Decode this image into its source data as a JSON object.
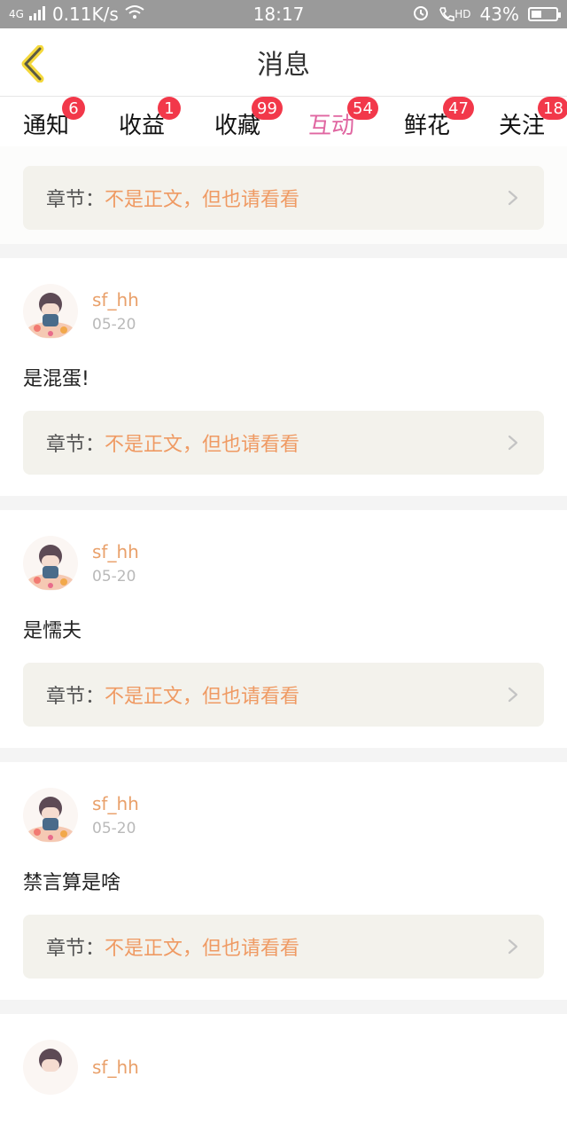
{
  "status_bar": {
    "network": "4G",
    "speed": "0.11K/s",
    "time": "18:17",
    "hd": "HD",
    "battery_percent": "43%",
    "battery_level": 0.43
  },
  "nav": {
    "title": "消息"
  },
  "tabs": [
    {
      "label": "通知",
      "badge": "6",
      "active": false
    },
    {
      "label": "收益",
      "badge": "1",
      "active": false
    },
    {
      "label": "收藏",
      "badge": "99",
      "active": false
    },
    {
      "label": "互动",
      "badge": "54",
      "active": true
    },
    {
      "label": "鲜花",
      "badge": "47",
      "active": false
    },
    {
      "label": "关注",
      "badge": "18",
      "active": false
    }
  ],
  "chapter_prefix": "章节：",
  "top_partial": {
    "chapter_title": "不是正文，但也请看看"
  },
  "messages": [
    {
      "username": "sf_hh",
      "date": "05-20",
      "comment": "是混蛋!",
      "chapter_title": "不是正文，但也请看看"
    },
    {
      "username": "sf_hh",
      "date": "05-20",
      "comment": "是懦夫",
      "chapter_title": "不是正文，但也请看看"
    },
    {
      "username": "sf_hh",
      "date": "05-20",
      "comment": "禁言算是啥",
      "chapter_title": "不是正文，但也请看看"
    }
  ],
  "bottom_partial": {
    "username": "sf_hh"
  }
}
